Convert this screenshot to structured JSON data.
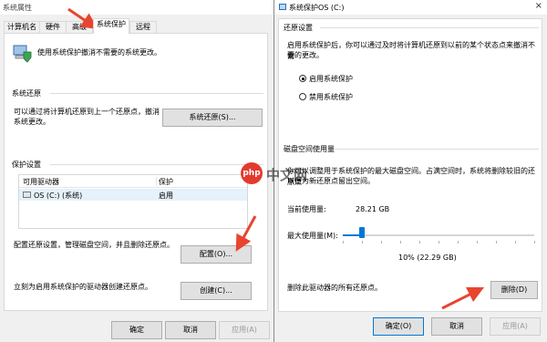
{
  "left_window": {
    "title": "系统属性",
    "tabs": [
      {
        "label": "计算机名",
        "active": false
      },
      {
        "label": "硬件",
        "active": false
      },
      {
        "label": "高级",
        "active": false
      },
      {
        "label": "系统保护",
        "active": true
      },
      {
        "label": "远程",
        "active": false
      }
    ],
    "intro_text": "使用系统保护撤消不需要的系统更改。",
    "system_restore": {
      "heading": "系统还原",
      "description_line1": "可以通过将计算机还原到上一个还原点，撤消",
      "description_line2": "系统更改。",
      "button": "系统还原(S)..."
    },
    "protection": {
      "heading": "保护设置",
      "col_drive": "可用驱动器",
      "col_protect": "保护",
      "rows": [
        {
          "drive": "OS (C:) (系统)",
          "status": "启用"
        }
      ],
      "configure_text": "配置还原设置，管理磁盘空间，并且删除还原点。",
      "configure_button": "配置(O)...",
      "create_text": "立刻为启用系统保护的驱动器创建还原点。",
      "create_button": "创建(C)..."
    },
    "footer": {
      "ok": "确定",
      "cancel": "取消",
      "apply": "应用(A)"
    }
  },
  "right_window": {
    "title": "系统保护OS (C:)",
    "close_glyph": "×",
    "restore_settings": {
      "heading": "还原设置",
      "description_line1": "启用系统保护后，你可以通过及时将计算机还原到以前的某个状态点来撤消不需",
      "description_line2": "要的更改。",
      "options": [
        {
          "label": "启用系统保护",
          "checked": true
        },
        {
          "label": "禁用系统保护",
          "checked": false
        }
      ]
    },
    "disk_usage": {
      "heading": "磁盘空间使用量",
      "description_line1": "你可以调整用于系统保护的最大磁盘空间。占满空间时，系统将删除较旧的还原点",
      "description_line2": "以便为新还原点留出空间。",
      "current_label": "当前使用量:",
      "current_value": "28.21 GB",
      "max_label": "最大使用量(M):",
      "slider_fraction": 0.1,
      "slider_caption": "10% (22.29 GB)",
      "delete_text": "删除此驱动器的所有还原点。",
      "delete_button": "删除(D)"
    },
    "footer": {
      "ok": "确定(O)",
      "cancel": "取消",
      "apply": "应用(A)"
    }
  },
  "watermark": {
    "badge": "php",
    "text": "中文网"
  },
  "colors": {
    "accent": "#0078d7",
    "arrow": "#e8452f",
    "selection": "#e5f1fb"
  }
}
